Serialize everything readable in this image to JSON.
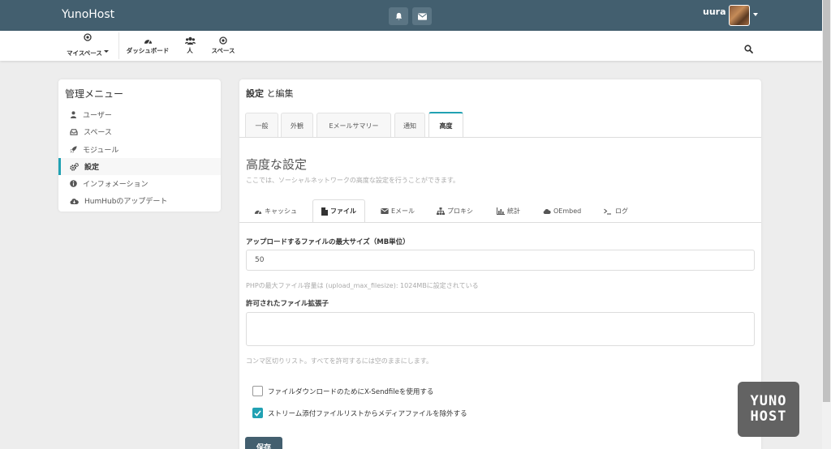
{
  "app": {
    "brand": "YunoHost"
  },
  "user": {
    "name": "uura"
  },
  "nav": {
    "items": [
      {
        "label": "マイスペース",
        "icon": "dot-circle-icon"
      },
      {
        "label": "ダッシュボード",
        "icon": "dashboard-icon"
      },
      {
        "label": "人",
        "icon": "users-icon"
      },
      {
        "label": "スペース",
        "icon": "dot-circle-icon"
      }
    ]
  },
  "sidebar": {
    "title": "管理メニュー",
    "items": [
      {
        "label": "ユーザー",
        "icon": "user-icon"
      },
      {
        "label": "スペース",
        "icon": "inbox-icon"
      },
      {
        "label": "モジュール",
        "icon": "rocket-icon"
      },
      {
        "label": "設定",
        "icon": "cogs-icon",
        "active": true
      },
      {
        "label": "インフォメーション",
        "icon": "info-circle-icon"
      },
      {
        "label": "HumHubのアップデート",
        "icon": "cloud-download-icon"
      }
    ]
  },
  "main": {
    "heading_bold": "設定",
    "heading_rest": " と編集",
    "tabs": [
      "一般",
      "外観",
      "Eメールサマリー",
      "通知",
      "高度"
    ],
    "active_tab": 4,
    "section_title": "高度な設定",
    "section_desc": "ここでは、ソーシャルネットワークの高度な設定を行うことができます。",
    "subtabs": [
      {
        "label": "キャッシュ",
        "icon": "dashboard-icon"
      },
      {
        "label": "ファイル",
        "icon": "file-icon"
      },
      {
        "label": "Eメール",
        "icon": "envelope-icon"
      },
      {
        "label": "プロキシ",
        "icon": "sitemap-icon"
      },
      {
        "label": "統計",
        "icon": "bar-chart-icon"
      },
      {
        "label": "OEmbed",
        "icon": "cloud-icon"
      },
      {
        "label": "ログ",
        "icon": "terminal-icon"
      }
    ],
    "active_subtab": 1,
    "form": {
      "max_size_label": "アップロードするファイルの最大サイズ（MB単位）",
      "max_size_value": "50",
      "max_size_help": "PHPの最大ファイル容量は (upload_max_filesize): 1024MBに設定されている",
      "ext_label": "許可されたファイル拡張子",
      "ext_value": "",
      "ext_help": "コンマ区切りリスト。すべてを許可するには空のままにします。",
      "xsendfile_label": "ファイルダウンロードのためにX-Sendfileを使用する",
      "xsendfile_checked": false,
      "exclude_media_label": "ストリーム添付ファイルリストからメディアファイルを除外する",
      "exclude_media_checked": true,
      "save_label": "保存"
    }
  },
  "badge": {
    "line1": "YUNO",
    "line2": "HOST"
  },
  "colors": {
    "topbar": "#435f6f",
    "accent": "#21a1b3",
    "background": "#ededed"
  }
}
